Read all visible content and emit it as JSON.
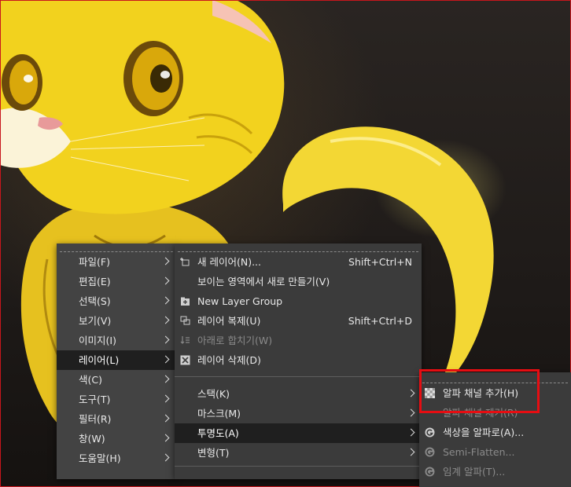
{
  "context_menu": {
    "items": [
      {
        "label": "파일(F)"
      },
      {
        "label": "편집(E)"
      },
      {
        "label": "선택(S)"
      },
      {
        "label": "보기(V)"
      },
      {
        "label": "이미지(I)"
      },
      {
        "label": "레이어(L)"
      },
      {
        "label": "색(C)"
      },
      {
        "label": "도구(T)"
      },
      {
        "label": "필터(R)"
      },
      {
        "label": "창(W)"
      },
      {
        "label": "도움말(H)"
      }
    ]
  },
  "layer_menu": {
    "items": [
      {
        "label": "새 레이어(N)...",
        "shortcut": "Shift+Ctrl+N",
        "icon": "new-layer-icon"
      },
      {
        "label": "보이는 영역에서 새로 만들기(V)",
        "shortcut": ""
      },
      {
        "label": "New Layer Group",
        "shortcut": "",
        "icon": "new-layer-group-icon"
      },
      {
        "label": "레이어 복제(U)",
        "shortcut": "Shift+Ctrl+D",
        "icon": "duplicate-layer-icon"
      },
      {
        "label": "아래로 합치기(W)",
        "shortcut": "",
        "icon": "merge-down-icon"
      },
      {
        "label": "레이어 삭제(D)",
        "shortcut": "",
        "icon": "delete-layer-icon"
      }
    ],
    "submenus": [
      {
        "label": "스택(K)"
      },
      {
        "label": "마스크(M)"
      },
      {
        "label": "투명도(A)"
      },
      {
        "label": "변형(T)"
      }
    ]
  },
  "transparency_menu": {
    "items": [
      {
        "label": "알파 채널 추가(H)",
        "icon": "checkerboard-icon"
      },
      {
        "label": "알파 채널 제거(R)"
      },
      {
        "label": "색상을 알파로(A)...",
        "icon": "gegl-icon"
      },
      {
        "label": "Semi-Flatten...",
        "icon": "gegl-icon"
      },
      {
        "label": "임계 알파(T)...",
        "icon": "gegl-icon"
      }
    ]
  },
  "colors": {
    "menu_bg": "#434343",
    "active_bg": "#1f1f1f",
    "highlight": "#e60d12"
  }
}
